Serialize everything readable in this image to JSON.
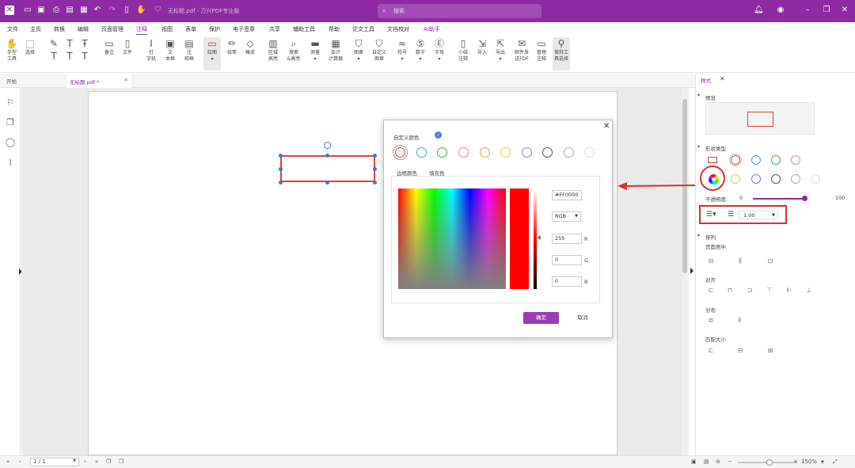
{
  "titlebar": {
    "doc_title": "无标题.pdf - 万兴PDF专业版",
    "search_placeholder": "搜索",
    "icons": [
      "app-logo-icon",
      "open-folder-icon",
      "save-icon",
      "print-icon",
      "save-as-icon",
      "export-icon",
      "undo-icon",
      "redo-icon",
      "file-icon",
      "hand-tool-icon",
      "favorite-icon"
    ],
    "window_controls": [
      "notification-icon",
      "account-icon",
      "menu-icon",
      "minimize-icon",
      "restore-icon",
      "close-icon"
    ]
  },
  "menubar": {
    "items": [
      "文件",
      "主页",
      "转换",
      "编辑",
      "页面管理",
      "注释",
      "视图",
      "表单",
      "保护",
      "电子签章",
      "共享",
      "辅助工具",
      "帮助",
      "论文工具",
      "文档校对",
      "AI助手"
    ],
    "active": "注释"
  },
  "toolbar": {
    "tools": [
      {
        "label": "手型\n工具",
        "icon": "hand-icon"
      },
      {
        "label": "选择",
        "icon": "select-icon"
      },
      {
        "label": "",
        "icon": "highlight-icon"
      },
      {
        "label": "",
        "icon": "text-icon"
      },
      {
        "label": "",
        "icon": "text-insert-icon"
      },
      {
        "label": "备注",
        "icon": "note-icon"
      },
      {
        "label": "文件",
        "icon": "attach-file-icon"
      },
      {
        "label": "打\n字机",
        "icon": "typewriter-icon"
      },
      {
        "label": "文\n本框",
        "icon": "textbox-icon"
      },
      {
        "label": "注\n释框",
        "icon": "callout-icon"
      },
      {
        "label": "绘图",
        "icon": "shape-icon"
      },
      {
        "label": "铅笔",
        "icon": "pencil-icon"
      },
      {
        "label": "橡皮",
        "icon": "eraser-icon"
      },
      {
        "label": "区域\n高亮",
        "icon": "area-highlight-icon"
      },
      {
        "label": "搜索\n&高亮",
        "icon": "search-highlight-icon"
      },
      {
        "label": "测量",
        "icon": "measure-icon"
      },
      {
        "label": "会计\n计算器",
        "icon": "calculator-icon"
      },
      {
        "label": "图章",
        "icon": "stamp-icon"
      },
      {
        "label": "自定义\n图章",
        "icon": "custom-stamp-icon"
      },
      {
        "label": "符号",
        "icon": "symbol-icon"
      },
      {
        "label": "数字",
        "icon": "number-icon"
      },
      {
        "label": "字母",
        "icon": "letter-icon"
      },
      {
        "label": "小结\n注释",
        "icon": "summary-icon"
      },
      {
        "label": "导入",
        "icon": "import-icon"
      },
      {
        "label": "导出",
        "icon": "export-annot-icon"
      },
      {
        "label": "邮件发\n送FDF",
        "icon": "email-fdf-icon"
      },
      {
        "label": "管理\n注释",
        "icon": "manage-annot-icon"
      },
      {
        "label": "保持工\n具选择",
        "icon": "pin-icon"
      }
    ],
    "glyph_rows_extra": [
      "T",
      "T",
      "T"
    ]
  },
  "tabbar": {
    "home_label": "开始",
    "doc_tab": "无标题.pdf *"
  },
  "leftbar": {
    "icons": [
      "bookmark-icon",
      "thumbnail-icon",
      "comment-icon",
      "attachment-icon"
    ]
  },
  "dialog": {
    "title": "自定义颜色",
    "tabs": [
      "边框颜色",
      "填充色"
    ],
    "swatches": [
      "#e04040",
      "#3aa7e0",
      "#3db04a",
      "#e67fb0",
      "#e8a040",
      "#e8c840",
      "#7b7be0",
      "#555555",
      "#aaaaaa",
      "#dddddd"
    ],
    "hex_value": "#FF0000",
    "mode": "RGB",
    "r": "255",
    "g": "0",
    "b": "0",
    "r_label": "R",
    "g_label": "G",
    "b_label": "B",
    "ok_label": "确定",
    "cancel_label": "取消"
  },
  "rpanel": {
    "tab": "样式",
    "preview_section": "预览",
    "shape_type_section": "形状类型",
    "opacity_label": "不透明度:",
    "opacity_min": "0",
    "opacity_max": "100",
    "opacity_value": 1.0,
    "line_width": "1.00",
    "arrange_section": "排列",
    "center_label": "页面居中",
    "align_label": "对齐",
    "distribute_label": "分布",
    "match_size_label": "匹配大小",
    "swatches_row1": [
      "#e04040",
      "#3aa7e0",
      "#3db04a",
      "#e67fb0"
    ],
    "swatches_row2": [
      "#e8c840",
      "#7b7be0",
      "#555555",
      "#aaaaaa",
      "#dddddd"
    ]
  },
  "statusbar": {
    "page": "1 / 1",
    "zoom": "150%"
  },
  "colors": {
    "brand": "#8e2aa4",
    "annotation_red": "#d93030"
  }
}
